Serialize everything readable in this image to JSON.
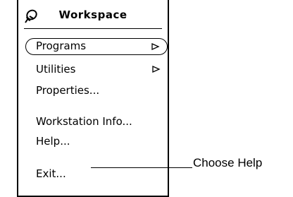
{
  "menu": {
    "title": "Workspace",
    "pin_icon": "pushpin-icon",
    "items": [
      {
        "label": "Programs",
        "submenu": true,
        "default": true
      },
      {
        "label": "Utilities",
        "submenu": true
      },
      {
        "label": "Properties..."
      },
      {
        "label": "Workstation Info..."
      },
      {
        "label": "Help..."
      },
      {
        "label": "Exit..."
      }
    ]
  },
  "callout": {
    "text": "Choose Help"
  }
}
